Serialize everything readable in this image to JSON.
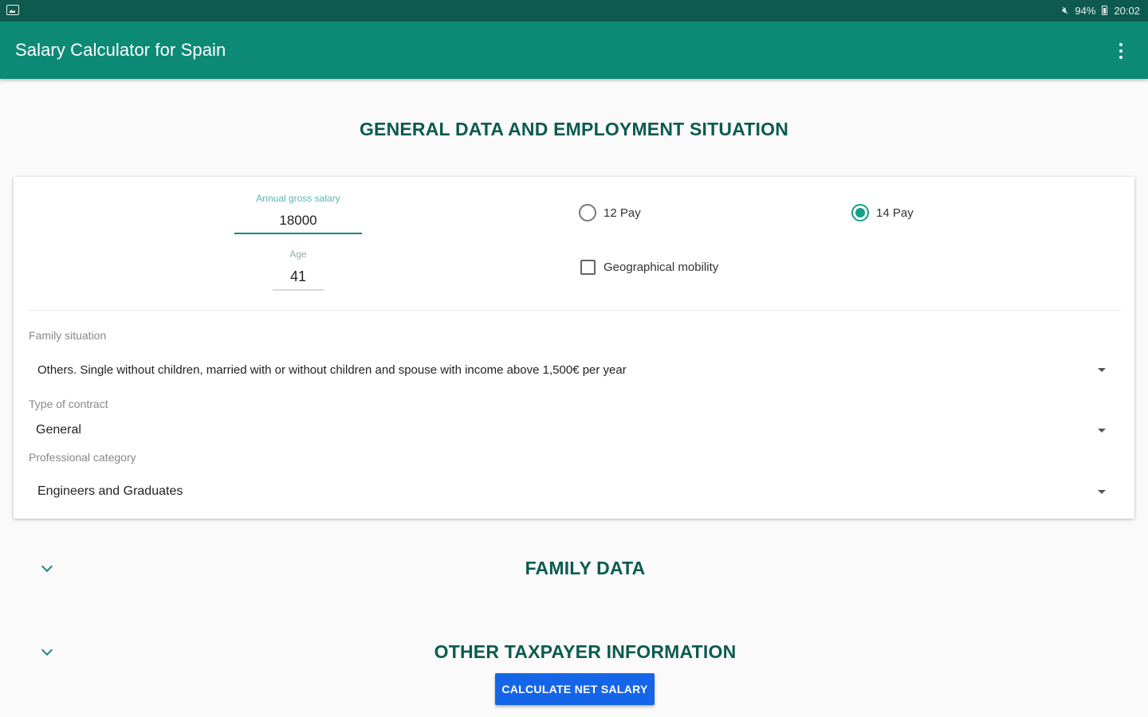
{
  "status_bar": {
    "battery": "94%",
    "time": "20:02",
    "icons": [
      "image-icon",
      "mute-icon",
      "battery-icon"
    ]
  },
  "app_bar": {
    "title": "Salary Calculator for Spain",
    "menu_icon": "overflow-menu-icon"
  },
  "general_section": {
    "heading": "GENERAL DATA AND EMPLOYMENT SITUATION",
    "salary": {
      "label": "Annual gross salary",
      "value": "18000"
    },
    "age": {
      "label": "Age",
      "value": "41"
    },
    "payments": [
      {
        "label": "12 Pay",
        "selected": false
      },
      {
        "label": "14 Pay",
        "selected": true
      }
    ],
    "geo_mobility": {
      "label": "Geographical mobility",
      "checked": false
    },
    "family_situation": {
      "label": "Family situation",
      "value": "Others. Single without children, married with or without children and spouse with income above 1,500€ per year"
    },
    "contract_type": {
      "label": "Type of contract",
      "value": "General"
    },
    "professional_category": {
      "label": "Professional category",
      "value": "Engineers and Graduates"
    }
  },
  "family_section": {
    "heading": "FAMILY DATA"
  },
  "other_section": {
    "heading": "OTHER TAXPAYER INFORMATION"
  },
  "calculate_button": {
    "label": "CALCULATE NET SALARY"
  },
  "colors": {
    "status_bar": "#0f5a4e",
    "app_bar": "#0d8a76",
    "heading": "#0b5b4f",
    "accent": "#16a085",
    "button": "#1565e8"
  }
}
